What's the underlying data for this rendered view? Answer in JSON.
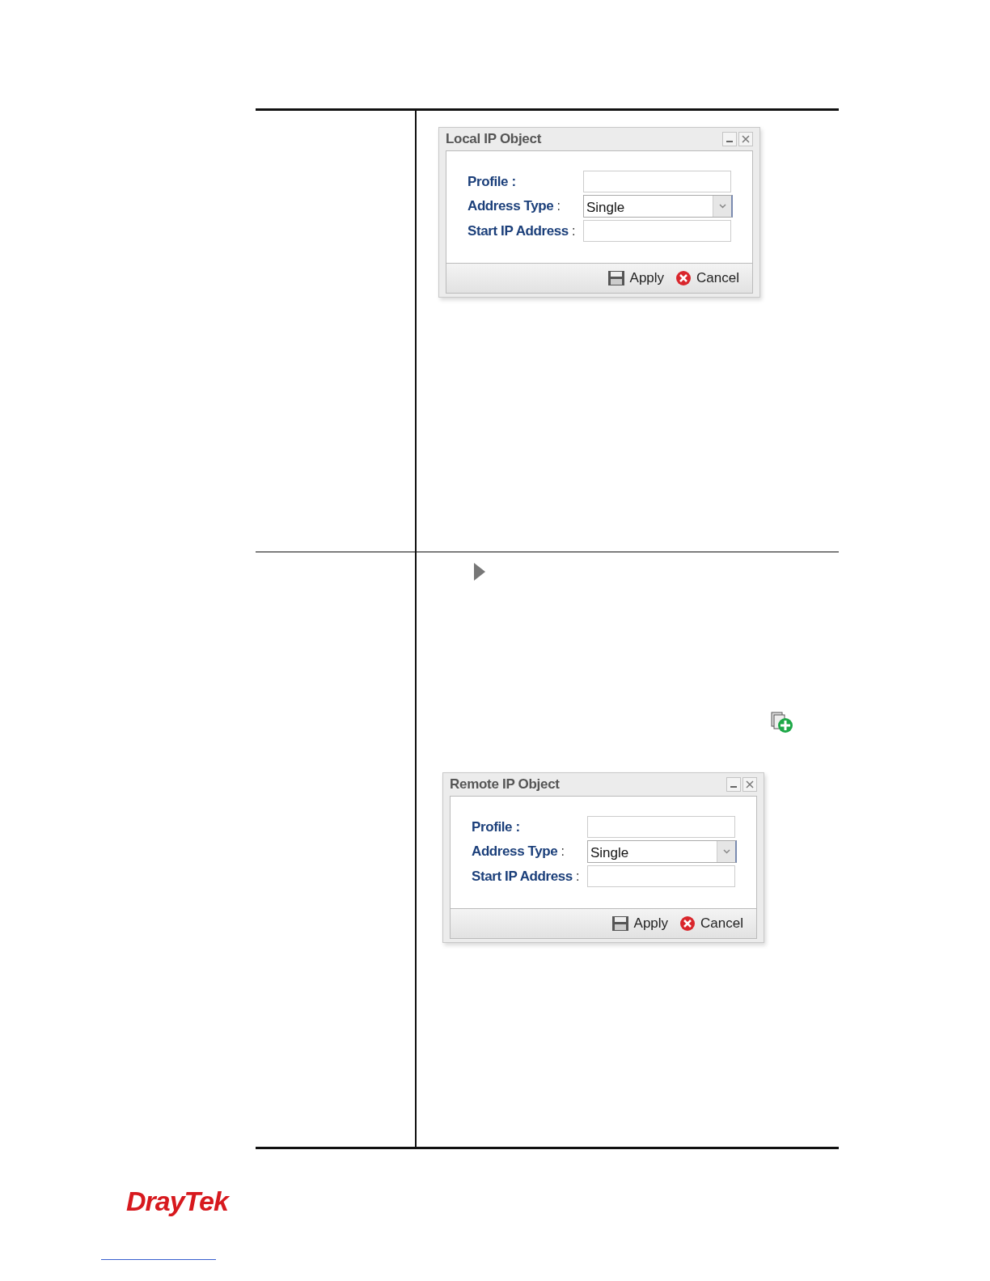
{
  "rows": [
    {
      "kind": "plain",
      "dialog": {
        "title": "Local IP Object",
        "fields": [
          {
            "kind": "text",
            "label": "Profile :"
          },
          {
            "kind": "select",
            "label": "Address Type",
            "separator": ":",
            "value": "Single"
          },
          {
            "kind": "text",
            "label": "Start IP Address",
            "separator": ":"
          }
        ],
        "buttons": [
          {
            "kind": "apply",
            "label": "Apply"
          },
          {
            "kind": "cancel",
            "label": "Cancel"
          }
        ]
      }
    },
    {
      "kind": "pointer",
      "dialog": {
        "title": "Remote IP Object",
        "fields": [
          {
            "kind": "text",
            "label": "Profile :"
          },
          {
            "kind": "select",
            "label": "Address Type",
            "separator": ":",
            "value": "Single"
          },
          {
            "kind": "text",
            "label": "Start IP Address",
            "separator": ":"
          }
        ],
        "buttons": [
          {
            "kind": "apply",
            "label": "Apply"
          },
          {
            "kind": "cancel",
            "label": "Cancel"
          }
        ]
      }
    }
  ],
  "footer": {
    "logo": "DrayTek"
  }
}
